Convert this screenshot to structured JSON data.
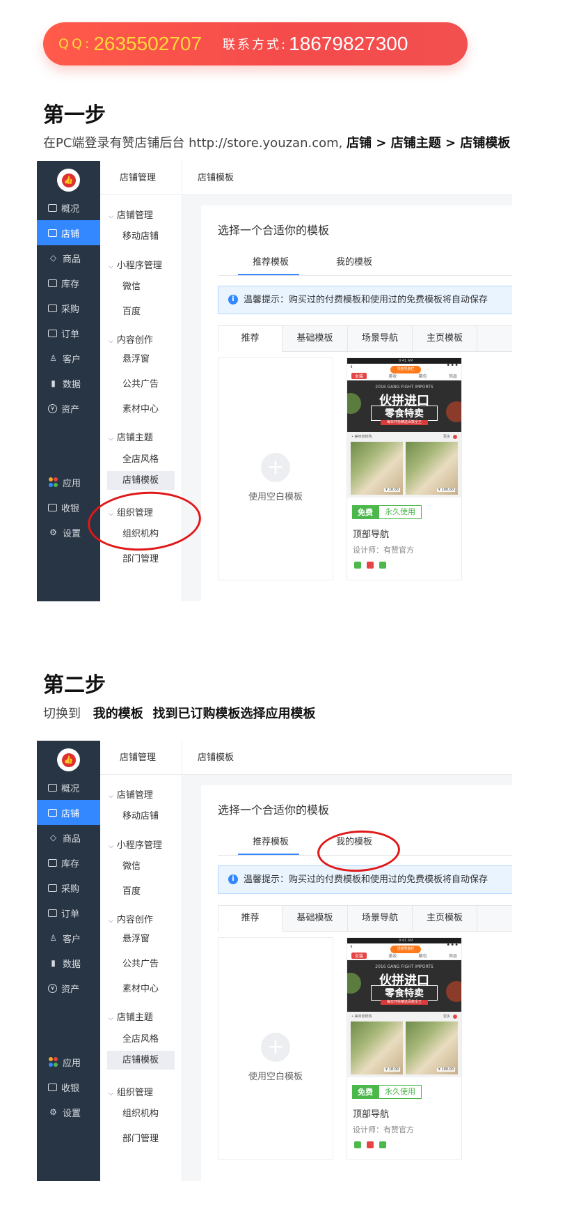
{
  "banner": {
    "qq_label": "QQ:",
    "qq_number": "2635502707",
    "contact_label": "联系方式:",
    "contact_number": "18679827300"
  },
  "step1": {
    "title": "第一步",
    "desc_prefix": "在PC端登录有赞店铺后台 http://store.youzan.com,",
    "desc_path": "店铺 > 店铺主题 > 店铺模板"
  },
  "step2": {
    "title": "第二步",
    "desc_prefix": "切换到",
    "desc_bold_1": "我的模板",
    "desc_bold_2": "找到已订购模板选择应用模板"
  },
  "screenshot": {
    "logo_icon": "thumbs-up-icon",
    "sidebar": [
      {
        "label": "概况",
        "icon": "monitor-icon"
      },
      {
        "label": "店铺",
        "icon": "store-icon",
        "active": true
      },
      {
        "label": "商品",
        "icon": "tag-icon"
      },
      {
        "label": "库存",
        "icon": "inventory-icon"
      },
      {
        "label": "采购",
        "icon": "purchase-icon"
      },
      {
        "label": "订单",
        "icon": "order-icon"
      },
      {
        "label": "客户",
        "icon": "user-icon"
      },
      {
        "label": "数据",
        "icon": "chart-icon"
      },
      {
        "label": "资产",
        "icon": "asset-icon"
      }
    ],
    "sidebar_bottom": [
      {
        "label": "应用",
        "icon": "apps-icon"
      },
      {
        "label": "收银",
        "icon": "cashier-icon"
      },
      {
        "label": "设置",
        "icon": "gear-icon"
      }
    ],
    "subnav_title": "店铺管理",
    "subnav": {
      "g1": "店铺管理",
      "g1_items": [
        "移动店铺"
      ],
      "g2": "小程序管理",
      "g2_items": [
        "微信",
        "百度"
      ],
      "g3": "内容创作",
      "g3_items": [
        "悬浮窗",
        "公共广告",
        "素材中心"
      ],
      "g4": "店铺主题",
      "g4_items": [
        "全店风格",
        "店铺模板"
      ],
      "g5": "组织管理",
      "g5_items": [
        "组织机构",
        "部门管理"
      ]
    },
    "breadcrumb": "店铺模板",
    "card_title": "选择一个合适你的模板",
    "tabs": [
      "推荐模板",
      "我的模板"
    ],
    "notice": "温馨提示：购买过的付费模板和使用过的免费模板将自动保存",
    "segments": [
      "推荐",
      "基础模板",
      "场景导航",
      "主页模板"
    ],
    "blank_label": "使用空白模板",
    "template": {
      "status_time": "9:41 AM",
      "bubble": "顶部导航栏",
      "cats": [
        "女装",
        "美妆",
        "箱包",
        "饰品"
      ],
      "hero_sub": "2016 GANG FIGHT IMPORTS",
      "hero_title": "伙拼进口",
      "hero_title2": "零食特卖",
      "hero_tag": "每日开抢精选百款全王",
      "strip": "• 美味尝鲜购",
      "strip_more": "更多",
      "price1": "¥ 18.00",
      "price2": "¥ 100.00",
      "badge_free": "免费",
      "badge_perm": "永久使用",
      "name": "顶部导航",
      "designer": "设计师：有赞官方"
    }
  },
  "colors": {
    "sidebar_bg": "#283544",
    "accent": "#3388ff",
    "highlight_ring": "#e01818",
    "free_green": "#4cb84c"
  }
}
